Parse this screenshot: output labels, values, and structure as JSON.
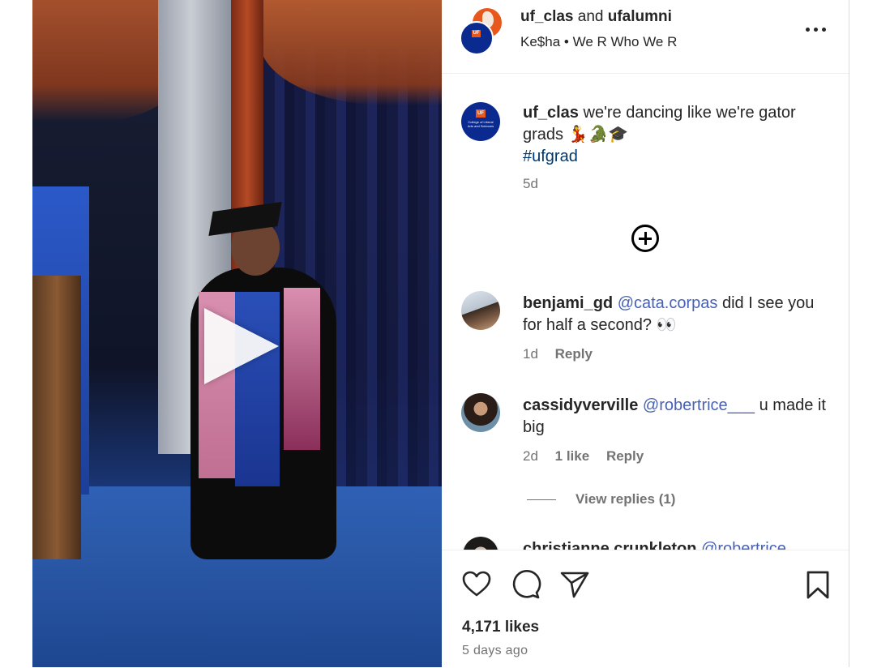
{
  "header": {
    "user1": "uf_clas",
    "joiner": "and",
    "user2": "ufalumni",
    "audio_artist": "Ke$ha",
    "audio_sep": "•",
    "audio_title": "We R Who We R",
    "avatar_logo": "UF"
  },
  "caption": {
    "username": "uf_clas",
    "text": "we're dancing like we're gator grads 💃🐊🎓",
    "hashtag": "#ufgrad",
    "time": "5d",
    "avatar_text": "College of Liberal Arts and Sciences"
  },
  "comments": [
    {
      "username": "benjami_gd",
      "mention": "@cata.corpas",
      "text": "did I see you for half a second? 👀",
      "time": "1d",
      "reply_label": "Reply"
    },
    {
      "username": "cassidyverville",
      "mention": "@robertrice___",
      "text": "u made it big",
      "time": "2d",
      "likes": "1 like",
      "reply_label": "Reply"
    },
    {
      "username": "christianne.crunkleton",
      "mention": "@robertrice___",
      "text": ""
    }
  ],
  "view_replies": "View replies (1)",
  "footer": {
    "likes": "4,171 likes",
    "time": "5 days ago"
  }
}
